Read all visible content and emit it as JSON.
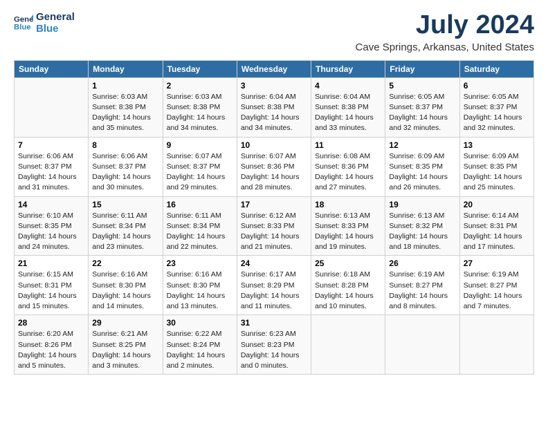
{
  "logo": {
    "line1": "General",
    "line2": "Blue"
  },
  "title": "July 2024",
  "location": "Cave Springs, Arkansas, United States",
  "days_header": [
    "Sunday",
    "Monday",
    "Tuesday",
    "Wednesday",
    "Thursday",
    "Friday",
    "Saturday"
  ],
  "weeks": [
    [
      {
        "day": "",
        "info": ""
      },
      {
        "day": "1",
        "info": "Sunrise: 6:03 AM\nSunset: 8:38 PM\nDaylight: 14 hours\nand 35 minutes."
      },
      {
        "day": "2",
        "info": "Sunrise: 6:03 AM\nSunset: 8:38 PM\nDaylight: 14 hours\nand 34 minutes."
      },
      {
        "day": "3",
        "info": "Sunrise: 6:04 AM\nSunset: 8:38 PM\nDaylight: 14 hours\nand 34 minutes."
      },
      {
        "day": "4",
        "info": "Sunrise: 6:04 AM\nSunset: 8:38 PM\nDaylight: 14 hours\nand 33 minutes."
      },
      {
        "day": "5",
        "info": "Sunrise: 6:05 AM\nSunset: 8:37 PM\nDaylight: 14 hours\nand 32 minutes."
      },
      {
        "day": "6",
        "info": "Sunrise: 6:05 AM\nSunset: 8:37 PM\nDaylight: 14 hours\nand 32 minutes."
      }
    ],
    [
      {
        "day": "7",
        "info": "Sunrise: 6:06 AM\nSunset: 8:37 PM\nDaylight: 14 hours\nand 31 minutes."
      },
      {
        "day": "8",
        "info": "Sunrise: 6:06 AM\nSunset: 8:37 PM\nDaylight: 14 hours\nand 30 minutes."
      },
      {
        "day": "9",
        "info": "Sunrise: 6:07 AM\nSunset: 8:37 PM\nDaylight: 14 hours\nand 29 minutes."
      },
      {
        "day": "10",
        "info": "Sunrise: 6:07 AM\nSunset: 8:36 PM\nDaylight: 14 hours\nand 28 minutes."
      },
      {
        "day": "11",
        "info": "Sunrise: 6:08 AM\nSunset: 8:36 PM\nDaylight: 14 hours\nand 27 minutes."
      },
      {
        "day": "12",
        "info": "Sunrise: 6:09 AM\nSunset: 8:35 PM\nDaylight: 14 hours\nand 26 minutes."
      },
      {
        "day": "13",
        "info": "Sunrise: 6:09 AM\nSunset: 8:35 PM\nDaylight: 14 hours\nand 25 minutes."
      }
    ],
    [
      {
        "day": "14",
        "info": "Sunrise: 6:10 AM\nSunset: 8:35 PM\nDaylight: 14 hours\nand 24 minutes."
      },
      {
        "day": "15",
        "info": "Sunrise: 6:11 AM\nSunset: 8:34 PM\nDaylight: 14 hours\nand 23 minutes."
      },
      {
        "day": "16",
        "info": "Sunrise: 6:11 AM\nSunset: 8:34 PM\nDaylight: 14 hours\nand 22 minutes."
      },
      {
        "day": "17",
        "info": "Sunrise: 6:12 AM\nSunset: 8:33 PM\nDaylight: 14 hours\nand 21 minutes."
      },
      {
        "day": "18",
        "info": "Sunrise: 6:13 AM\nSunset: 8:33 PM\nDaylight: 14 hours\nand 19 minutes."
      },
      {
        "day": "19",
        "info": "Sunrise: 6:13 AM\nSunset: 8:32 PM\nDaylight: 14 hours\nand 18 minutes."
      },
      {
        "day": "20",
        "info": "Sunrise: 6:14 AM\nSunset: 8:31 PM\nDaylight: 14 hours\nand 17 minutes."
      }
    ],
    [
      {
        "day": "21",
        "info": "Sunrise: 6:15 AM\nSunset: 8:31 PM\nDaylight: 14 hours\nand 15 minutes."
      },
      {
        "day": "22",
        "info": "Sunrise: 6:16 AM\nSunset: 8:30 PM\nDaylight: 14 hours\nand 14 minutes."
      },
      {
        "day": "23",
        "info": "Sunrise: 6:16 AM\nSunset: 8:30 PM\nDaylight: 14 hours\nand 13 minutes."
      },
      {
        "day": "24",
        "info": "Sunrise: 6:17 AM\nSunset: 8:29 PM\nDaylight: 14 hours\nand 11 minutes."
      },
      {
        "day": "25",
        "info": "Sunrise: 6:18 AM\nSunset: 8:28 PM\nDaylight: 14 hours\nand 10 minutes."
      },
      {
        "day": "26",
        "info": "Sunrise: 6:19 AM\nSunset: 8:27 PM\nDaylight: 14 hours\nand 8 minutes."
      },
      {
        "day": "27",
        "info": "Sunrise: 6:19 AM\nSunset: 8:27 PM\nDaylight: 14 hours\nand 7 minutes."
      }
    ],
    [
      {
        "day": "28",
        "info": "Sunrise: 6:20 AM\nSunset: 8:26 PM\nDaylight: 14 hours\nand 5 minutes."
      },
      {
        "day": "29",
        "info": "Sunrise: 6:21 AM\nSunset: 8:25 PM\nDaylight: 14 hours\nand 3 minutes."
      },
      {
        "day": "30",
        "info": "Sunrise: 6:22 AM\nSunset: 8:24 PM\nDaylight: 14 hours\nand 2 minutes."
      },
      {
        "day": "31",
        "info": "Sunrise: 6:23 AM\nSunset: 8:23 PM\nDaylight: 14 hours\nand 0 minutes."
      },
      {
        "day": "",
        "info": ""
      },
      {
        "day": "",
        "info": ""
      },
      {
        "day": "",
        "info": ""
      }
    ]
  ]
}
